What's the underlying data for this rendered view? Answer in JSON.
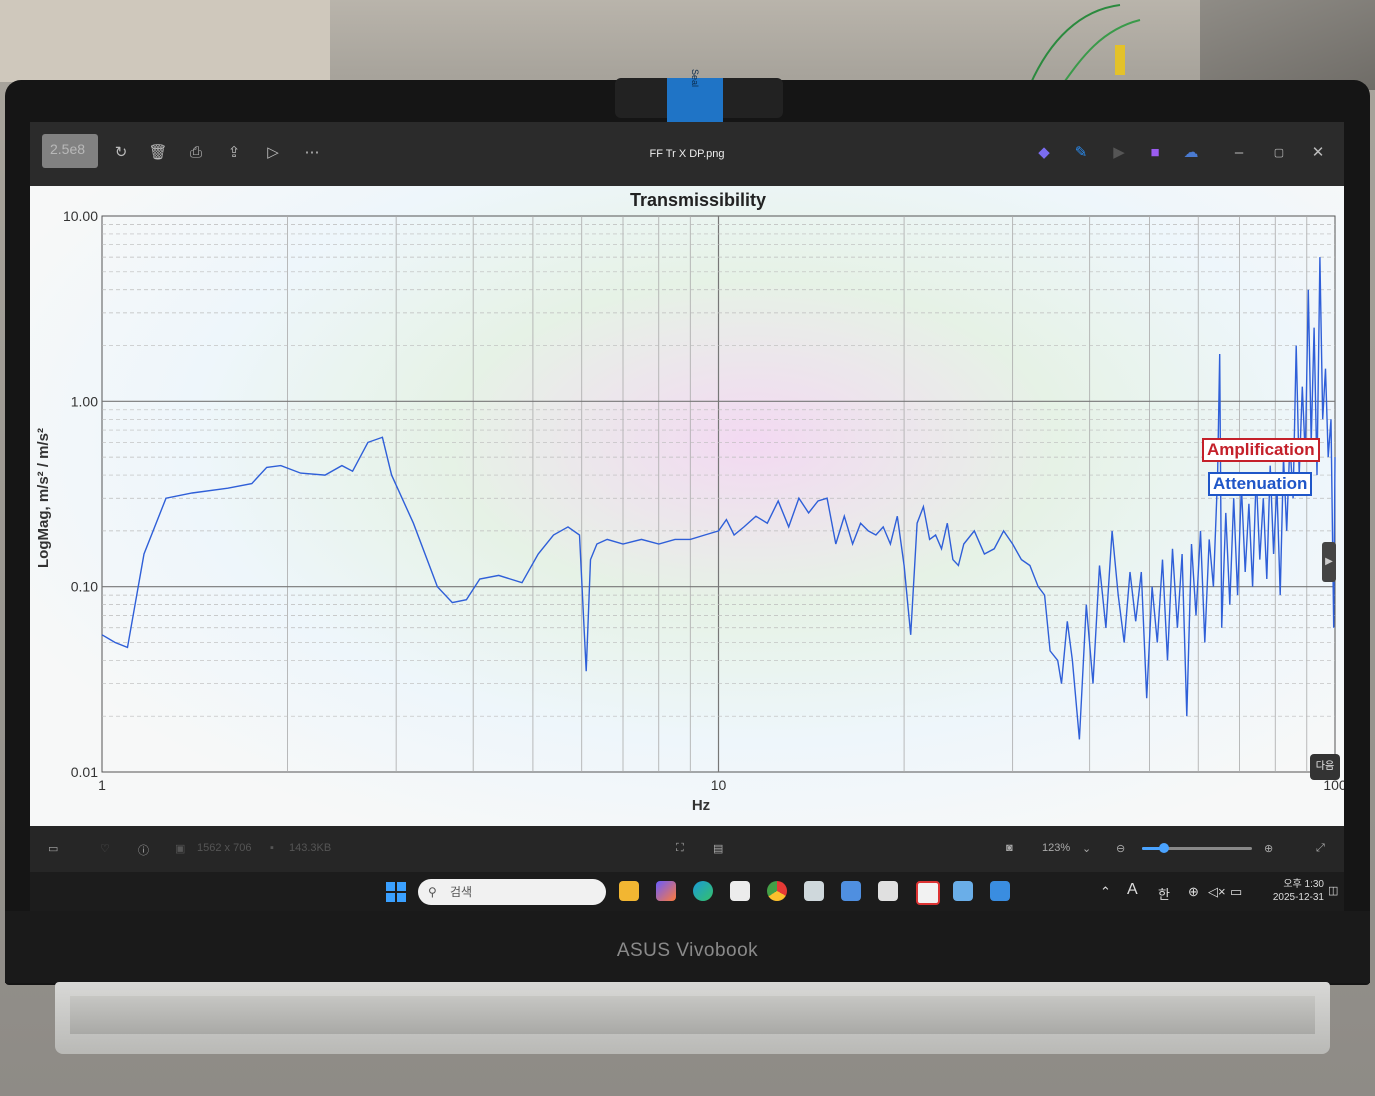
{
  "window": {
    "title": "FF Tr X DP.png",
    "thumb_label": "2.5e8"
  },
  "chart_data": {
    "type": "line",
    "title": "Transmissibility",
    "xlabel": "Hz",
    "ylabel": "LogMag, m/s² / m/s²",
    "x_scale": "log",
    "y_scale": "log",
    "xlim": [
      1,
      100
    ],
    "ylim": [
      0.01,
      10
    ],
    "x_ticks": [
      "1",
      "10",
      "100"
    ],
    "y_ticks": [
      "10.00",
      "1.00",
      "0.10",
      "0.01"
    ],
    "grid": true,
    "series": [
      {
        "color": "#2f5fd8",
        "points": [
          [
            1.0,
            0.055
          ],
          [
            1.05,
            0.05
          ],
          [
            1.1,
            0.047
          ],
          [
            1.17,
            0.15
          ],
          [
            1.27,
            0.3
          ],
          [
            1.4,
            0.32
          ],
          [
            1.6,
            0.34
          ],
          [
            1.75,
            0.36
          ],
          [
            1.85,
            0.44
          ],
          [
            1.95,
            0.45
          ],
          [
            2.1,
            0.41
          ],
          [
            2.3,
            0.4
          ],
          [
            2.45,
            0.45
          ],
          [
            2.55,
            0.42
          ],
          [
            2.7,
            0.6
          ],
          [
            2.85,
            0.64
          ],
          [
            2.95,
            0.4
          ],
          [
            3.2,
            0.22
          ],
          [
            3.5,
            0.1
          ],
          [
            3.7,
            0.082
          ],
          [
            3.9,
            0.085
          ],
          [
            4.1,
            0.11
          ],
          [
            4.4,
            0.115
          ],
          [
            4.8,
            0.105
          ],
          [
            5.1,
            0.15
          ],
          [
            5.4,
            0.19
          ],
          [
            5.7,
            0.21
          ],
          [
            5.95,
            0.19
          ],
          [
            6.1,
            0.035
          ],
          [
            6.2,
            0.14
          ],
          [
            6.35,
            0.17
          ],
          [
            6.6,
            0.18
          ],
          [
            7.0,
            0.17
          ],
          [
            7.5,
            0.18
          ],
          [
            8.0,
            0.17
          ],
          [
            8.5,
            0.18
          ],
          [
            9.0,
            0.18
          ],
          [
            9.5,
            0.19
          ],
          [
            10.0,
            0.2
          ],
          [
            10.3,
            0.23
          ],
          [
            10.6,
            0.19
          ],
          [
            11.0,
            0.21
          ],
          [
            11.5,
            0.24
          ],
          [
            12.0,
            0.22
          ],
          [
            12.5,
            0.29
          ],
          [
            13.0,
            0.21
          ],
          [
            13.5,
            0.3
          ],
          [
            14.0,
            0.25
          ],
          [
            14.5,
            0.29
          ],
          [
            15.0,
            0.3
          ],
          [
            15.5,
            0.17
          ],
          [
            16.0,
            0.24
          ],
          [
            16.5,
            0.17
          ],
          [
            17.0,
            0.22
          ],
          [
            17.5,
            0.2
          ],
          [
            18.0,
            0.19
          ],
          [
            18.5,
            0.21
          ],
          [
            19.0,
            0.17
          ],
          [
            19.5,
            0.24
          ],
          [
            20.0,
            0.13
          ],
          [
            20.5,
            0.055
          ],
          [
            21.0,
            0.22
          ],
          [
            21.5,
            0.27
          ],
          [
            22.0,
            0.18
          ],
          [
            22.5,
            0.19
          ],
          [
            23.0,
            0.16
          ],
          [
            23.5,
            0.22
          ],
          [
            24.0,
            0.14
          ],
          [
            24.5,
            0.13
          ],
          [
            25.0,
            0.17
          ],
          [
            26.0,
            0.2
          ],
          [
            27.0,
            0.15
          ],
          [
            28.0,
            0.16
          ],
          [
            29.0,
            0.2
          ],
          [
            30.0,
            0.17
          ],
          [
            31.0,
            0.14
          ],
          [
            32.0,
            0.13
          ],
          [
            33.0,
            0.1
          ],
          [
            33.8,
            0.09
          ],
          [
            34.5,
            0.045
          ],
          [
            35.5,
            0.04
          ],
          [
            36.0,
            0.03
          ],
          [
            36.8,
            0.065
          ],
          [
            37.5,
            0.04
          ],
          [
            38.5,
            0.015
          ],
          [
            39.5,
            0.08
          ],
          [
            40.5,
            0.03
          ],
          [
            41.5,
            0.13
          ],
          [
            42.5,
            0.06
          ],
          [
            43.5,
            0.2
          ],
          [
            44.5,
            0.09
          ],
          [
            45.5,
            0.05
          ],
          [
            46.5,
            0.12
          ],
          [
            47.5,
            0.065
          ],
          [
            48.5,
            0.12
          ],
          [
            49.5,
            0.025
          ],
          [
            50.5,
            0.1
          ],
          [
            51.5,
            0.05
          ],
          [
            52.5,
            0.14
          ],
          [
            53.5,
            0.04
          ],
          [
            54.5,
            0.16
          ],
          [
            55.5,
            0.06
          ],
          [
            56.5,
            0.15
          ],
          [
            57.5,
            0.02
          ],
          [
            58.5,
            0.17
          ],
          [
            59.5,
            0.07
          ],
          [
            60.5,
            0.2
          ],
          [
            61.5,
            0.05
          ],
          [
            62.5,
            0.18
          ],
          [
            63.5,
            0.1
          ],
          [
            64.5,
            0.4
          ],
          [
            65.0,
            1.8
          ],
          [
            65.5,
            0.06
          ],
          [
            66.5,
            0.25
          ],
          [
            67.5,
            0.08
          ],
          [
            68.5,
            0.3
          ],
          [
            69.5,
            0.09
          ],
          [
            70.5,
            0.35
          ],
          [
            71.5,
            0.12
          ],
          [
            72.5,
            0.28
          ],
          [
            73.5,
            0.1
          ],
          [
            74.5,
            0.4
          ],
          [
            75.5,
            0.14
          ],
          [
            76.5,
            0.3
          ],
          [
            77.5,
            0.11
          ],
          [
            78.5,
            0.45
          ],
          [
            79.5,
            0.15
          ],
          [
            80.5,
            0.35
          ],
          [
            81.5,
            0.09
          ],
          [
            82.5,
            0.5
          ],
          [
            83.5,
            0.2
          ],
          [
            84.5,
            0.6
          ],
          [
            85.5,
            0.3
          ],
          [
            86.5,
            2.0
          ],
          [
            87.5,
            0.4
          ],
          [
            88.5,
            1.2
          ],
          [
            89.5,
            0.5
          ],
          [
            90.5,
            4.0
          ],
          [
            91.5,
            0.6
          ],
          [
            92.5,
            2.5
          ],
          [
            93.5,
            0.4
          ],
          [
            94.5,
            6.0
          ],
          [
            95.5,
            0.8
          ],
          [
            96.5,
            1.5
          ],
          [
            97.5,
            0.5
          ],
          [
            98.5,
            0.8
          ],
          [
            99.5,
            0.06
          ],
          [
            100.0,
            0.5
          ]
        ]
      }
    ],
    "annotations": [
      "Amplification",
      "Attenuation"
    ]
  },
  "viewer": {
    "next_label": "다음",
    "dimensions": "1562 x 706",
    "filesize": "143.3KB",
    "zoom": "123%",
    "zoom_fraction": 0.2
  },
  "taskbar": {
    "search_placeholder": "검색",
    "ime_a": "A",
    "ime_han": "한",
    "time": "오후 1:30",
    "date": "2025-12-31"
  },
  "device": {
    "brand": "ASUS Vivobook"
  },
  "icons": {
    "titlebar": [
      "rotate-icon",
      "delete-icon",
      "print-icon",
      "share-icon",
      "slideshow-icon",
      "more-icon"
    ],
    "titlebar_right": [
      "copilot-icon",
      "edit-icon",
      "media-icon",
      "designer-icon",
      "cloud-icon",
      "minimize-icon",
      "maximize-icon",
      "close-icon"
    ],
    "statusbar": [
      "filmstrip-icon",
      "favorite-icon",
      "info-icon",
      "image-size-icon",
      "file-size-icon",
      "crop-icon",
      "scan-icon",
      "screenshot-icon",
      "zoom-out-icon",
      "zoom-in-icon",
      "fullscreen-icon"
    ],
    "taskbar_apps": [
      "file-explorer-icon",
      "copilot-icon",
      "edge-icon",
      "store-icon",
      "chrome-icon",
      "calculator-icon",
      "notepad-icon",
      "snipping-icon",
      "app-icon",
      "photos-icon",
      "paint-icon"
    ]
  }
}
